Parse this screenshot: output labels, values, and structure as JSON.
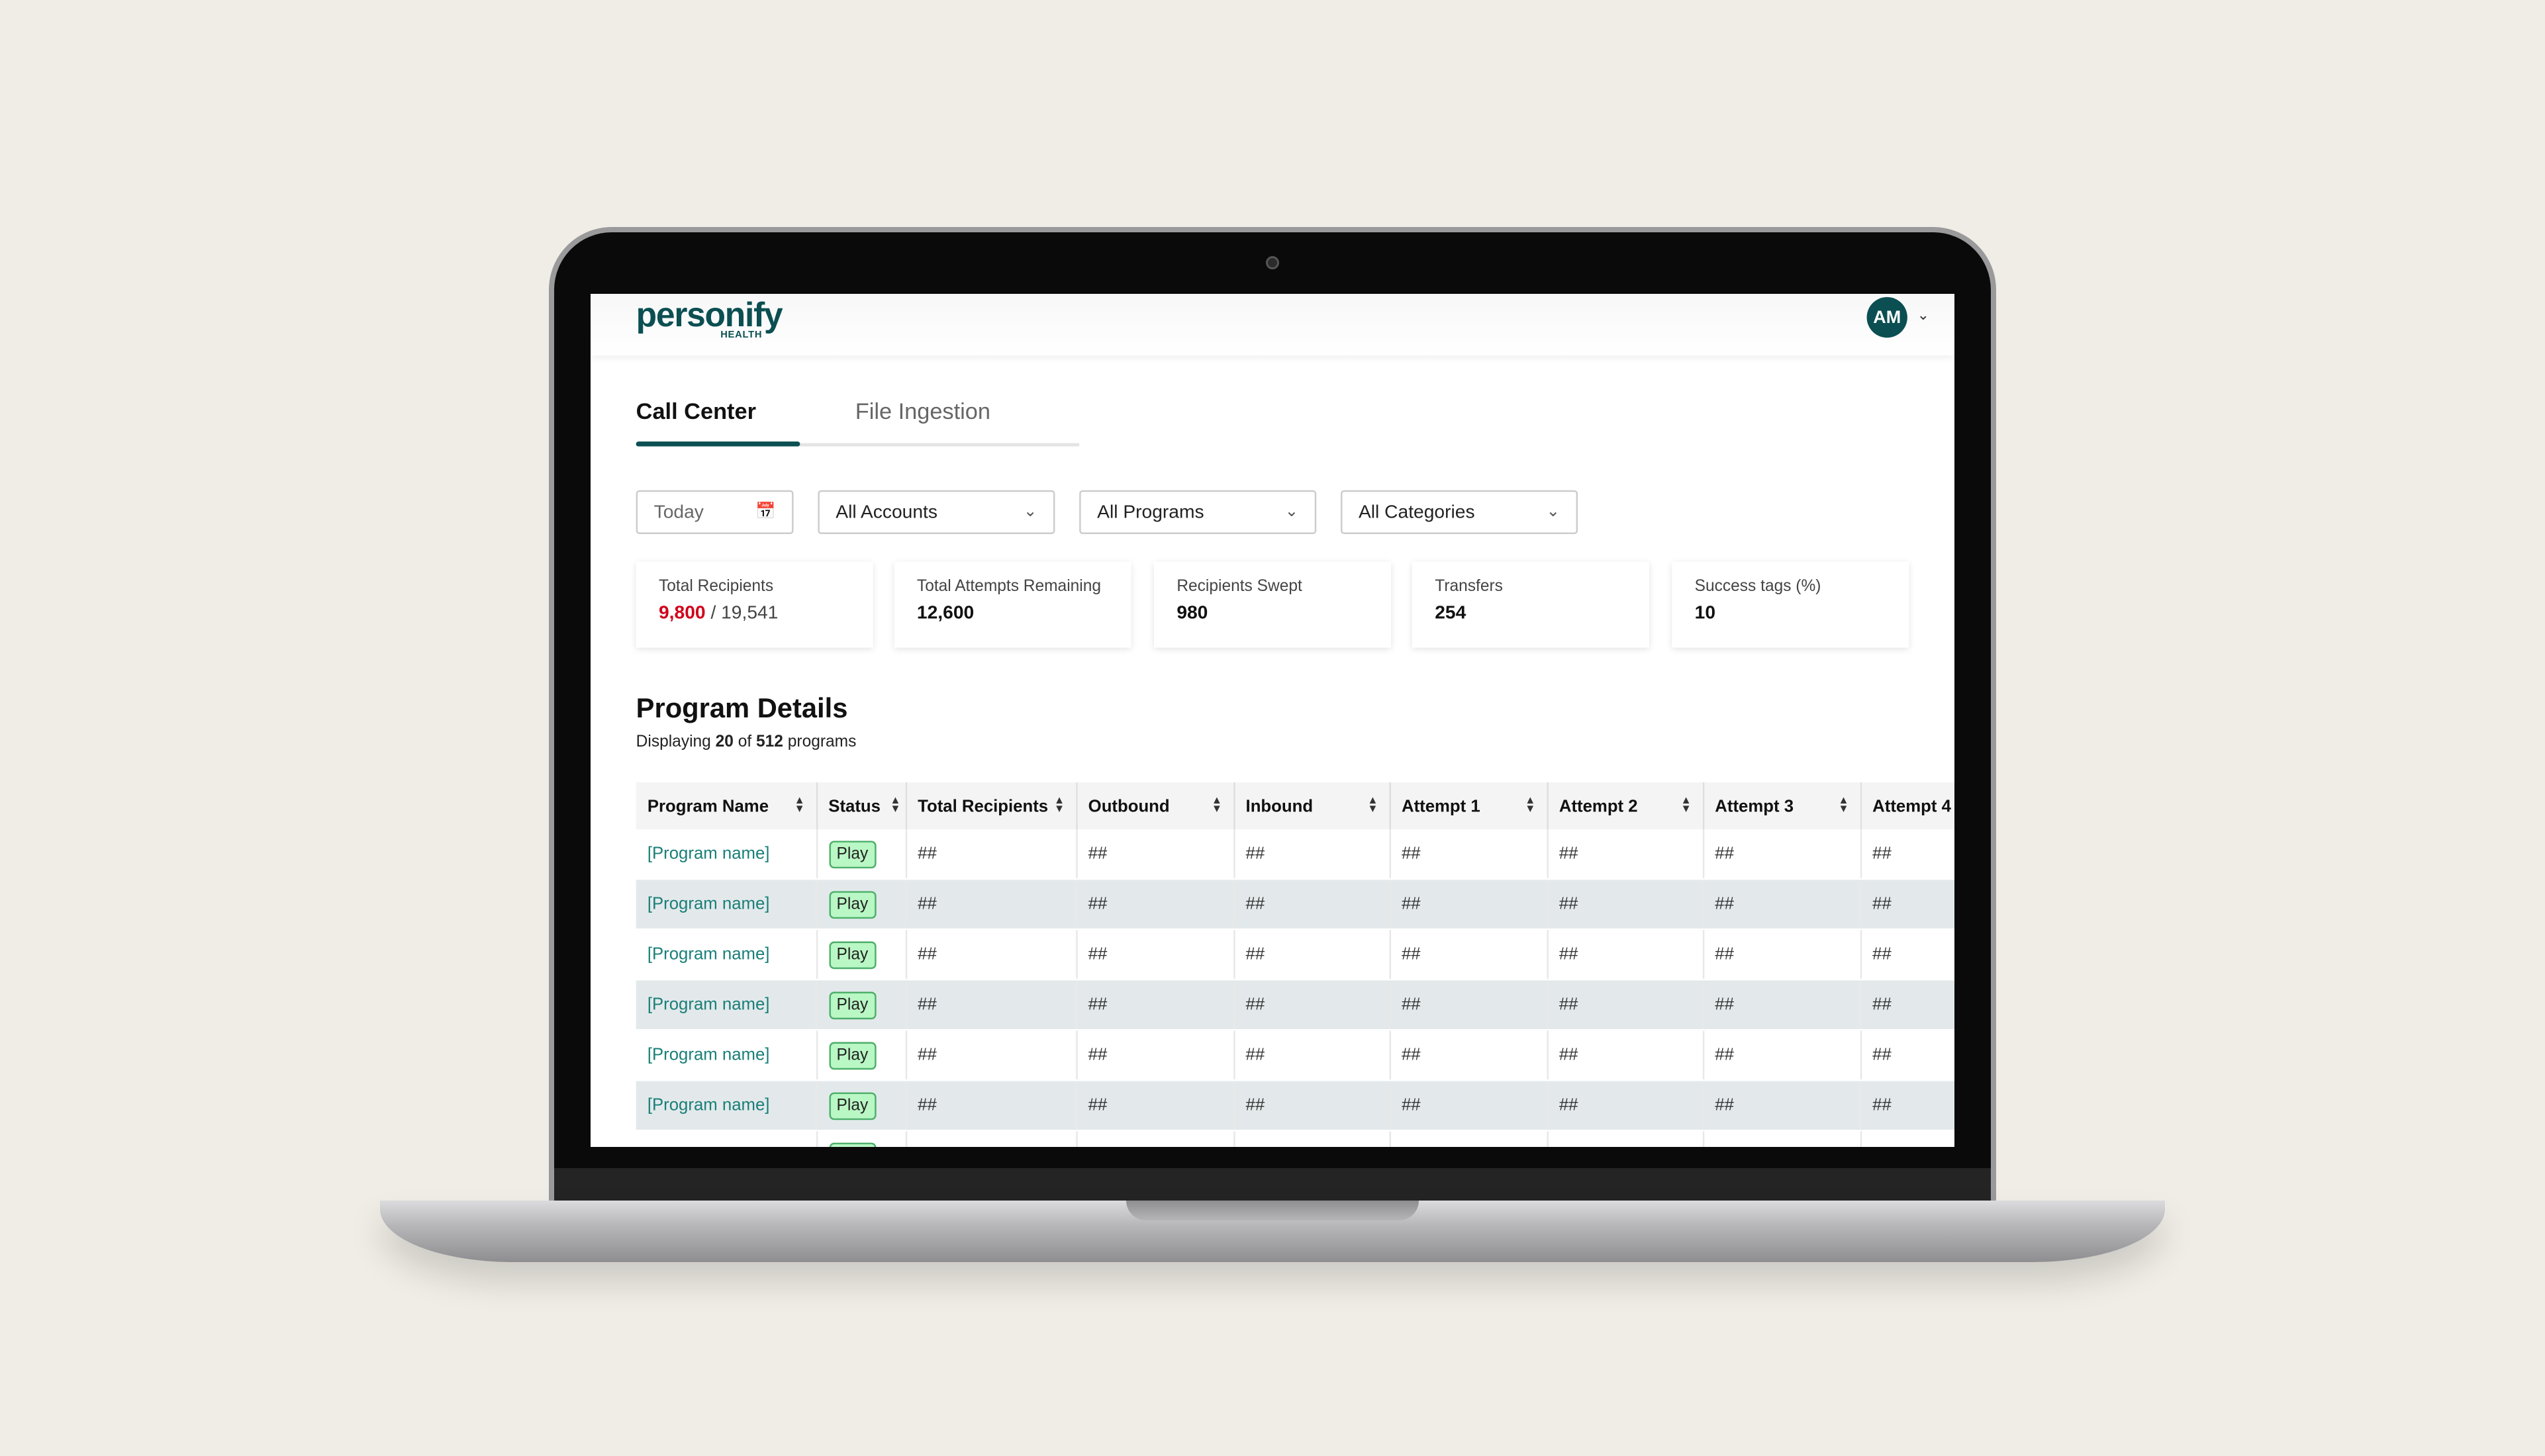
{
  "brand": {
    "logo_text": "personify",
    "logo_sub": "HEALTH",
    "colors": {
      "primary": "#0b4f52",
      "link": "#1a7f78",
      "alert": "#d0021b",
      "badge": "#b9f7c4"
    }
  },
  "user": {
    "initials": "AM"
  },
  "tabs": [
    {
      "label": "Call Center",
      "active": true
    },
    {
      "label": "File Ingestion",
      "active": false
    }
  ],
  "filters": {
    "date": "Today",
    "accounts": "All Accounts",
    "programs": "All Programs",
    "categories": "All Categories"
  },
  "stats": [
    {
      "label": "Total Recipients",
      "value": "9,800",
      "total": "/ 19,541"
    },
    {
      "label": "Total Attempts Remaining",
      "value": "12,600"
    },
    {
      "label": "Recipients Swept",
      "value": "980"
    },
    {
      "label": "Transfers",
      "value": "254"
    },
    {
      "label": "Success tags (%)",
      "value": "10"
    }
  ],
  "program_details": {
    "title": "Program Details",
    "sub_prefix": "Displaying",
    "shown": "20",
    "sub_of": "of",
    "total": "512",
    "sub_suffix": "programs",
    "columns": [
      "Program Name",
      "Status",
      "Total Recipients",
      "Outbound",
      "Inbound",
      "Attempt 1",
      "Attempt 2",
      "Attempt 3",
      "Attempt 4"
    ],
    "rows": [
      {
        "name": "[Program name]",
        "status": "Play",
        "values": [
          "##",
          "##",
          "##",
          "##",
          "##",
          "##",
          "##"
        ]
      },
      {
        "name": "[Program name]",
        "status": "Play",
        "values": [
          "##",
          "##",
          "##",
          "##",
          "##",
          "##",
          "##"
        ]
      },
      {
        "name": "[Program name]",
        "status": "Play",
        "values": [
          "##",
          "##",
          "##",
          "##",
          "##",
          "##",
          "##"
        ]
      },
      {
        "name": "[Program name]",
        "status": "Play",
        "values": [
          "##",
          "##",
          "##",
          "##",
          "##",
          "##",
          "##"
        ]
      },
      {
        "name": "[Program name]",
        "status": "Play",
        "values": [
          "##",
          "##",
          "##",
          "##",
          "##",
          "##",
          "##"
        ]
      },
      {
        "name": "[Program name]",
        "status": "Play",
        "values": [
          "##",
          "##",
          "##",
          "##",
          "##",
          "##",
          "##"
        ]
      },
      {
        "name": "",
        "status": "Play",
        "values": [
          "",
          "",
          "",
          "",
          "",
          "",
          ""
        ]
      }
    ]
  }
}
